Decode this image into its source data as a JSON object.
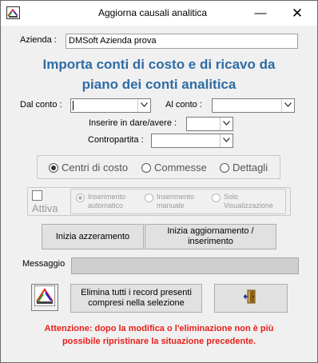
{
  "window": {
    "title": "Aggiorna causali analitica",
    "minimize_glyph": "—",
    "close_glyph": "✕",
    "app_icon": "dm-logo-icon"
  },
  "form": {
    "azienda_label": "Azienda :",
    "azienda_value": "DMSoft Azienda prova",
    "heading_line1": "Importa conti di costo e di ricavo da",
    "heading_line2": "piano dei conti analitica",
    "dal_conto_label": "Dal conto :",
    "dal_conto_value": "",
    "al_conto_label": "Al conto :",
    "al_conto_value": "",
    "dare_avere_label": "Inserire in dare/avere :",
    "dare_avere_value": "",
    "contropartita_label": "Contropartita :",
    "contropartita_value": ""
  },
  "type_options": {
    "items": [
      {
        "label": "Centri di costo",
        "selected": true
      },
      {
        "label": "Commesse",
        "selected": false
      },
      {
        "label": "Dettagli",
        "selected": false
      }
    ]
  },
  "attiva": {
    "label": "Attiva",
    "checked": false,
    "modes": [
      {
        "line1": "Inserimento",
        "line2": "automatico",
        "selected": true
      },
      {
        "line1": "Inserimento",
        "line2": "manuale",
        "selected": false
      },
      {
        "line1": "Solo",
        "line2": "Visualizzazione",
        "selected": false
      }
    ]
  },
  "actions": {
    "azzeramento_label": "Inizia azzeramento",
    "aggiornamento_line1": "Inizia aggiornamento /",
    "aggiornamento_line2": "inserimento",
    "messaggio_label": "Messaggio",
    "elimina_line1": "Elimina tutti i record presenti",
    "elimina_line2": "compresi nella selezione",
    "logo_icon": "dm-logo-button-icon",
    "exit_icon": "exit-door-icon"
  },
  "warning": {
    "line1": "Attenzione: dopo la modifica o l'eliminazione non è più",
    "line2": "possibile ripristinare la situazione precedente."
  },
  "colors": {
    "heading": "#2e6ca4",
    "warning": "#e8201a",
    "background": "#f0f0f0"
  }
}
